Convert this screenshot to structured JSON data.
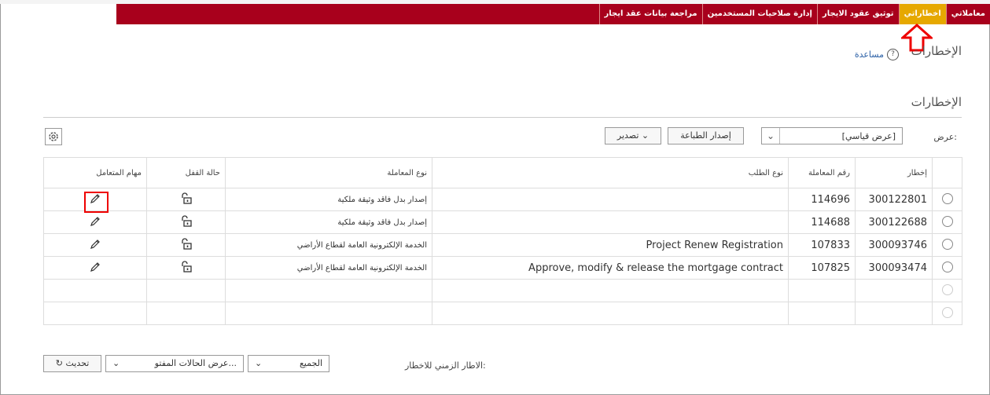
{
  "nav": {
    "tabs": [
      "معاملاتي",
      "اخطاراتي",
      "توثيق عقود الايجار",
      "إدارة صلاحيات المستخدمين",
      "مراجعة بيانات عقد ايجار"
    ],
    "active_index": 1,
    "bar_color": "#a8001c",
    "active_color": "#e6a800"
  },
  "page": {
    "title": "الإخطارات",
    "help_label": "مساعدة",
    "section_title": "الإخطارات"
  },
  "toolbar": {
    "view_label": "عرض:",
    "view_value": "[عرض قياسي]",
    "print_label": "إصدار الطباعة",
    "export_label": "تصدير"
  },
  "table": {
    "headers": [
      "إخطار",
      "رقم المعاملة",
      "نوع الطلب",
      "نوع المعاملة",
      "حالة القفل",
      "مهام المتعامل"
    ],
    "rows": [
      {
        "notification": "300122801",
        "transaction": "114696",
        "request_type": "",
        "transaction_type": "إصدار بدل فاقد وثيقة ملكية"
      },
      {
        "notification": "300122688",
        "transaction": "114688",
        "request_type": "",
        "transaction_type": "إصدار بدل فاقد وثيقة ملكية"
      },
      {
        "notification": "300093746",
        "transaction": "107833",
        "request_type": "Project Renew Registration",
        "transaction_type": "الخدمة الإلكترونية العامة لقطاع الأراضي"
      },
      {
        "notification": "300093474",
        "transaction": "107825",
        "request_type": "Approve, modify & release the mortgage contract",
        "transaction_type": "الخدمة الإلكترونية العامة لقطاع الأراضي"
      }
    ]
  },
  "footer": {
    "timeframe_label": "الاطار الزمني للاخطار:",
    "timeframe_value": "الجميع",
    "status_value": "عرض الحالات المفتو...",
    "refresh_label": "تحديث"
  }
}
